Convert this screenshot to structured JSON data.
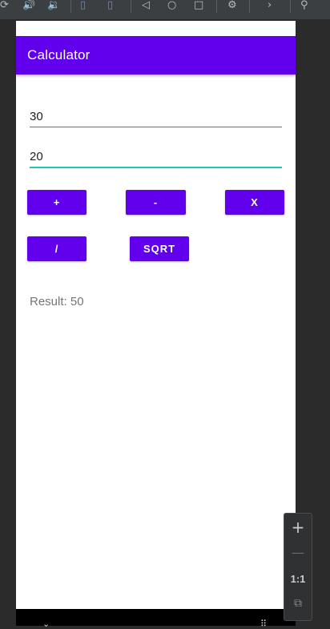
{
  "toolbar": {
    "icons": [
      "rotate-icon",
      "volume-up-icon",
      "volume-down-icon",
      "rotate-left-icon",
      "rotate-right-icon",
      "back-icon",
      "home-icon",
      "overview-icon",
      "settings-icon",
      "more-icon",
      "screenshot-zoom-icon"
    ]
  },
  "app": {
    "title": "Calculator",
    "accent_color": "#6200ee",
    "first_number": "30",
    "second_number": "20",
    "buttons": {
      "add": "+",
      "subtract": "-",
      "multiply": "X",
      "divide": "/",
      "sqrt": "SQRT"
    },
    "result": "Result: 50"
  },
  "zoom": {
    "zoom_in": "+",
    "zoom_out": "—",
    "actual_size": "1:1"
  }
}
